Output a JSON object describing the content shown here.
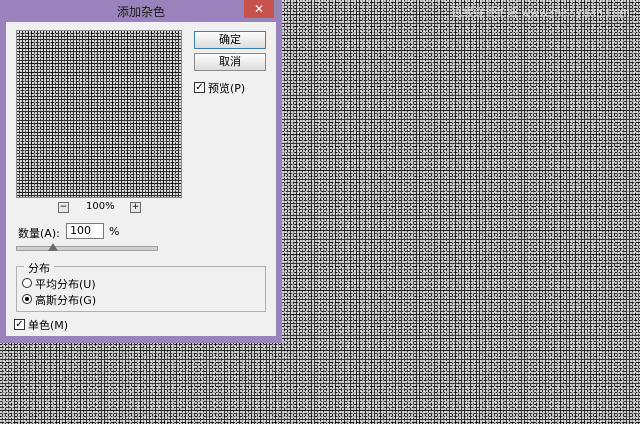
{
  "dialog": {
    "title": "添加杂色",
    "close_glyph": "✕",
    "ok_label": "确定",
    "cancel_label": "取消",
    "preview_checkbox_label": "预览(P)",
    "preview_checked": true,
    "zoom_level": "100%",
    "zoom_minus": "−",
    "zoom_plus": "+",
    "amount_label": "数量(A):",
    "amount_value": "100",
    "amount_unit": "%",
    "distribution_group_title": "分布",
    "distribution_options": [
      {
        "label": "平均分布(U)",
        "selected": false
      },
      {
        "label": "高斯分布(G)",
        "selected": true
      }
    ],
    "monochromatic_label": "单色(M)",
    "monochromatic_checked": true,
    "check_glyph": "✓"
  },
  "watermark": "思缘设计论坛 www.missyuan.com"
}
